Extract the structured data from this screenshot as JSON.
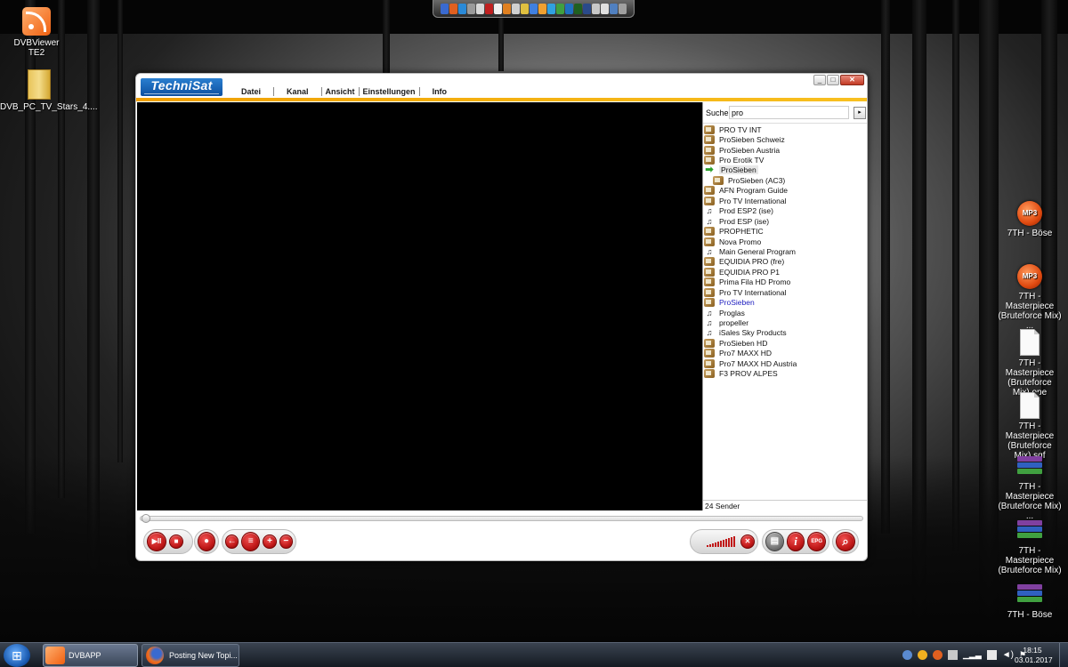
{
  "desktop": {
    "icons_left": [
      {
        "label": "DVBViewer TE2",
        "type": "rss"
      },
      {
        "label": "DVB_PC_TV_Stars_4....",
        "type": "folder"
      }
    ],
    "icons_right": [
      {
        "label": "7TH - Böse",
        "type": "mp3",
        "glyph": "MP3"
      },
      {
        "label": "7TH - Masterpiece (Bruteforce Mix) ...",
        "type": "mp3",
        "glyph": "MP3"
      },
      {
        "label": "7TH - Masterpiece (Bruteforce Mix).ope",
        "type": "doc"
      },
      {
        "label": "7TH - Masterpiece (Bruteforce Mix).sqf",
        "type": "doc"
      },
      {
        "label": "7TH - Masterpiece (Bruteforce Mix) ...",
        "type": "rar"
      },
      {
        "label": "7TH - Masterpiece (Bruteforce Mix)",
        "type": "rar"
      },
      {
        "label": "7TH - Böse",
        "type": "rar"
      }
    ]
  },
  "app": {
    "logo": "TechniSat",
    "menu": [
      "Datei",
      "Kanal",
      "Ansicht",
      "Einstellungen",
      "Info"
    ],
    "window_controls": {
      "minimize": "_",
      "maximize": "□",
      "close": "✕"
    },
    "search": {
      "label": "Suche",
      "value": "pro",
      "go": "▸"
    },
    "channels": [
      {
        "name": "PRO TV INT",
        "icon": "tv"
      },
      {
        "name": "ProSieben Schweiz",
        "icon": "tv"
      },
      {
        "name": "ProSieben Austria",
        "icon": "tv"
      },
      {
        "name": "Pro Erotik TV",
        "icon": "tv"
      },
      {
        "name": "ProSieben",
        "icon": "arrow",
        "current": true
      },
      {
        "name": "ProSieben (AC3)",
        "icon": "tv",
        "sub": true
      },
      {
        "name": "AFN Program Guide",
        "icon": "tv"
      },
      {
        "name": "Pro TV International",
        "icon": "tv"
      },
      {
        "name": "Prod ESP2 (ise)",
        "icon": "radio"
      },
      {
        "name": "Prod ESP (ise)",
        "icon": "radio"
      },
      {
        "name": "PROPHETIC",
        "icon": "tv"
      },
      {
        "name": "Nova Promo",
        "icon": "tv"
      },
      {
        "name": "Main General Program",
        "icon": "radio"
      },
      {
        "name": "EQUIDIA PRO (fre)",
        "icon": "tv"
      },
      {
        "name": "EQUIDIA PRO P1",
        "icon": "tv"
      },
      {
        "name": "Prima Fila HD Promo",
        "icon": "tv"
      },
      {
        "name": "Pro TV International",
        "icon": "tv"
      },
      {
        "name": "ProSieben",
        "icon": "tv",
        "highlight": true
      },
      {
        "name": "Proglas",
        "icon": "radio"
      },
      {
        "name": "propeller",
        "icon": "radio"
      },
      {
        "name": "iSales Sky Products",
        "icon": "radio"
      },
      {
        "name": "ProSieben HD",
        "icon": "tv"
      },
      {
        "name": "Pro7 MAXX HD",
        "icon": "tv"
      },
      {
        "name": "Pro7 MAXX HD Austria",
        "icon": "tv"
      },
      {
        "name": "F3 PROV ALPES",
        "icon": "tv"
      }
    ],
    "channel_count": "24 Sender",
    "controls": {
      "play_pause": "▶II",
      "stop": "■",
      "record": "●",
      "back": "←",
      "list": "≡",
      "plus": "+",
      "minus": "−",
      "mute": "✕",
      "teletext": "▤",
      "info": "i",
      "epg": "EPG",
      "search": "⌕"
    },
    "colors": {
      "accent": "#f0a000",
      "button": "#c01818"
    }
  },
  "taskbar": {
    "start": "⊞",
    "tasks": [
      {
        "label": "DVBAPP",
        "icon": "rss-icon"
      },
      {
        "label": "Posting New Topi...",
        "icon": "firefox-icon"
      }
    ],
    "clock": {
      "time": "18:15",
      "date": "03.01.2017"
    }
  }
}
